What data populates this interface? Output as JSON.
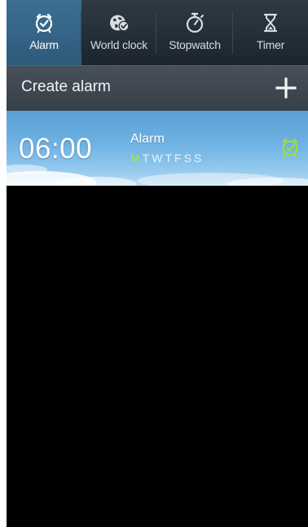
{
  "tabs": [
    {
      "label": "Alarm",
      "icon": "alarm-clock-icon",
      "active": true
    },
    {
      "label": "World clock",
      "icon": "globe-icon",
      "active": false
    },
    {
      "label": "Stopwatch",
      "icon": "stopwatch-icon",
      "active": false
    },
    {
      "label": "Timer",
      "icon": "hourglass-icon",
      "active": false
    }
  ],
  "create_bar": {
    "label": "Create alarm",
    "add_icon": "plus-icon"
  },
  "alarms": [
    {
      "time": "06:00",
      "name": "Alarm",
      "days": [
        {
          "letter": "M",
          "on": true
        },
        {
          "letter": "T",
          "on": false
        },
        {
          "letter": "W",
          "on": false
        },
        {
          "letter": "T",
          "on": false
        },
        {
          "letter": "F",
          "on": false
        },
        {
          "letter": "S",
          "on": false
        },
        {
          "letter": "S",
          "on": false
        }
      ],
      "toggle_icon": "alarm-on-icon",
      "enabled": true
    }
  ],
  "colors": {
    "active_tab": "#3c6f93",
    "active_day": "#a5e83a",
    "alarm_on_icon": "#9be03a"
  }
}
